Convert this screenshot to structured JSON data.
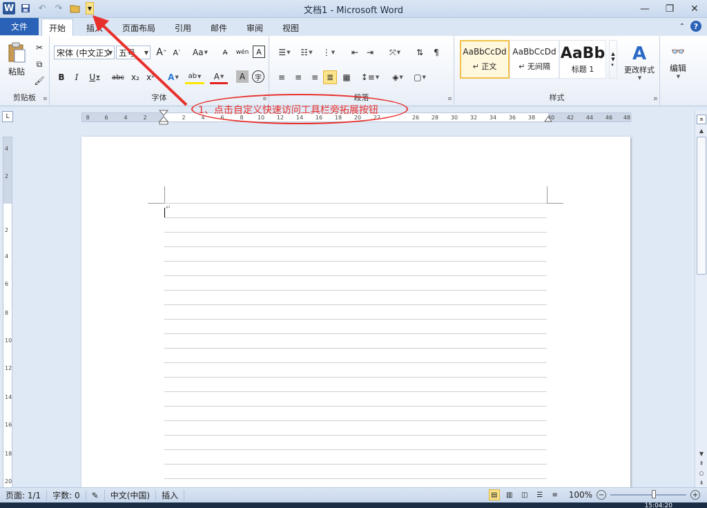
{
  "titlebar": {
    "title": "文档1  -  Microsoft Word",
    "logo": "W",
    "minimize": "—",
    "restore": "❐",
    "close": "✕"
  },
  "tabs": {
    "file": "文件",
    "items": [
      "开始",
      "插入",
      "页面布局",
      "引用",
      "邮件",
      "审阅",
      "视图"
    ],
    "active": "开始"
  },
  "ribbon": {
    "clipboard": {
      "label": "剪贴板",
      "paste": "粘贴"
    },
    "font": {
      "label": "字体",
      "font_name": "宋体 (中文正文",
      "font_size": "五号",
      "grow": "A",
      "shrink": "A",
      "change_case": "Aa",
      "bold": "B",
      "italic": "I",
      "underline": "U",
      "strike": "abc",
      "subscript": "x₂",
      "superscript": "x²"
    },
    "paragraph": {
      "label": "段落"
    },
    "styles": {
      "label": "样式",
      "items": [
        {
          "sample": "AaBbCcDd",
          "name": "↵ 正文"
        },
        {
          "sample": "AaBbCcDd",
          "name": "↵ 无间隔"
        },
        {
          "sample": "AaBb",
          "name": "标题 1"
        }
      ],
      "change_styles": "更改样式"
    },
    "editing": {
      "label": "编辑"
    }
  },
  "ruler": {
    "h_ticks": [
      "8",
      "6",
      "4",
      "2",
      "2",
      "4",
      "6",
      "8",
      "10",
      "12",
      "14",
      "16",
      "18",
      "20",
      "22",
      "26",
      "28",
      "30",
      "32",
      "34",
      "36",
      "38",
      "40",
      "42",
      "44",
      "46",
      "48"
    ],
    "v_ticks": [
      "4",
      "2",
      "2",
      "4",
      "6",
      "8",
      "10",
      "12",
      "14",
      "16",
      "18",
      "20"
    ]
  },
  "annotation": {
    "text": "1、点击自定义快速访问工具栏旁拓展按钮"
  },
  "status": {
    "page": "页面: 1/1",
    "words": "字数: 0",
    "language": "中文(中国)",
    "mode": "插入",
    "zoom": "100%",
    "clock": "15:04:20"
  }
}
